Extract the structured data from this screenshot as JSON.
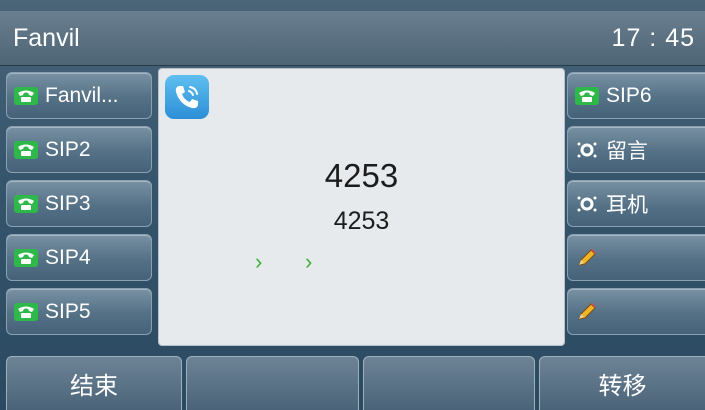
{
  "header": {
    "brand": "Fanvil",
    "time": "17 : 45"
  },
  "left_keys": [
    {
      "label": "Fanvil...",
      "icon": "phone-icon"
    },
    {
      "label": "SIP2",
      "icon": "phone-icon"
    },
    {
      "label": "SIP3",
      "icon": "phone-icon"
    },
    {
      "label": "SIP4",
      "icon": "phone-icon"
    },
    {
      "label": "SIP5",
      "icon": "phone-icon"
    }
  ],
  "right_keys": [
    {
      "label": "SIP6",
      "icon": "phone-icon"
    },
    {
      "label": "留言",
      "icon": "voicemail-icon"
    },
    {
      "label": "耳机",
      "icon": "headset-icon"
    },
    {
      "label": "",
      "icon": "pencil-icon"
    },
    {
      "label": "",
      "icon": "pencil-icon"
    }
  ],
  "call": {
    "number_primary": "4253",
    "number_secondary": "4253",
    "arrow1": "›",
    "arrow2": "›"
  },
  "softkeys": {
    "end": "结束",
    "blank1": "",
    "blank2": "",
    "transfer": "转移"
  },
  "colors": {
    "phone_green": "#2eb84a",
    "accent_blue": "#2c8fd6",
    "arrow_green": "#3fae3a"
  }
}
